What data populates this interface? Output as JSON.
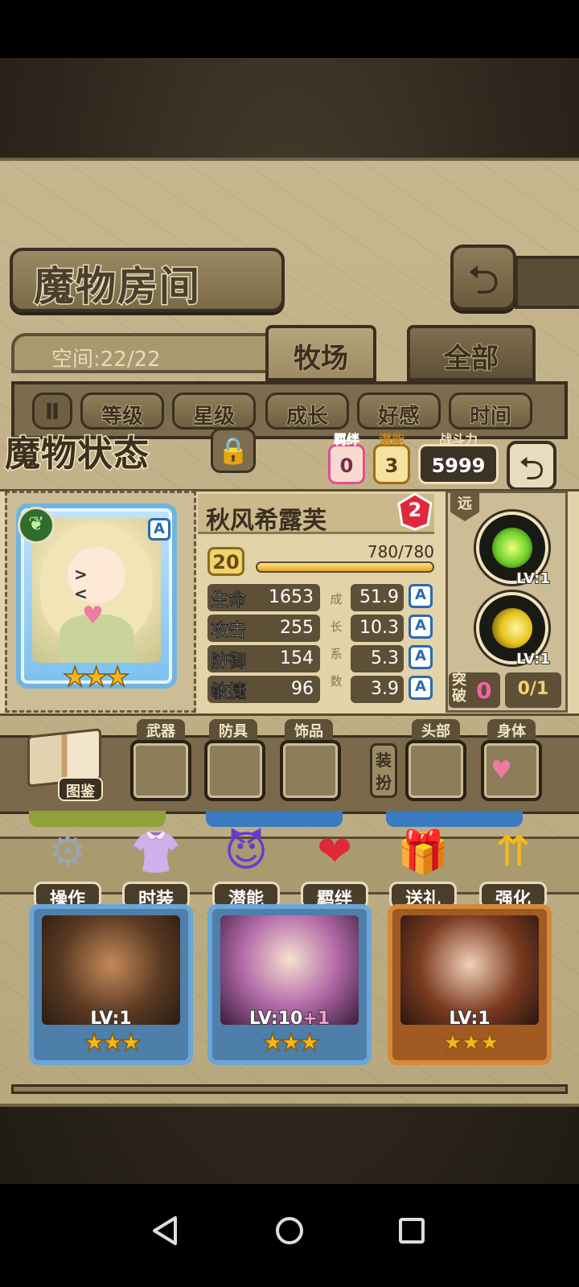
{
  "header": {
    "title": "魔物房间",
    "back_icon": "return-arrow-icon"
  },
  "space": {
    "label": "空间:22/22"
  },
  "tabs": [
    {
      "label": "牧场",
      "active": true
    },
    {
      "label": "全部",
      "active": false
    }
  ],
  "filters": {
    "pause_icon": "pause-icon",
    "items": [
      "等级",
      "星级",
      "成长",
      "好感",
      "时间"
    ]
  },
  "status": {
    "title": "魔物状态",
    "bond": {
      "label": "羁绊",
      "value": "0"
    },
    "potential": {
      "label": "潜能",
      "value": "3"
    },
    "power": {
      "label": "战斗力",
      "value": "5999"
    }
  },
  "monster": {
    "name": "秋风希露芙",
    "awaken_count": "2",
    "level": "20",
    "exp": "780/780",
    "exp_fraction": 1.0,
    "rank": "A",
    "stars": 3,
    "range": "远",
    "stats": [
      {
        "name": "生命",
        "value": "1653",
        "growth": "51.9",
        "grade": "A"
      },
      {
        "name": "攻击",
        "value": "255",
        "growth": "10.3",
        "grade": "A"
      },
      {
        "name": "防御",
        "value": "154",
        "growth": "5.3",
        "grade": "A"
      },
      {
        "name": "敏捷",
        "value": "96",
        "growth": "3.9",
        "grade": "A"
      }
    ],
    "growth_label": "成长系数",
    "skills": [
      {
        "lv": "LV:1"
      },
      {
        "lv": "LV:1"
      }
    ],
    "breakthrough": {
      "label": "突破",
      "count": "0",
      "progress": "0/1"
    }
  },
  "equipment": {
    "book_label": "图鉴",
    "slots": [
      "武器",
      "防具",
      "饰品"
    ],
    "dress_label": "装扮",
    "dress_slots": [
      "头部",
      "身体"
    ]
  },
  "actions": [
    "操作",
    "时装",
    "潜能",
    "羁绊",
    "送礼",
    "强化"
  ],
  "background_cards": [
    {
      "level": "LV:1",
      "plus": "",
      "stars": 3
    },
    {
      "level": "LV:10",
      "plus": "+1",
      "stars": 3
    },
    {
      "level": "LV:1",
      "plus": "",
      "stars": 3
    }
  ]
}
